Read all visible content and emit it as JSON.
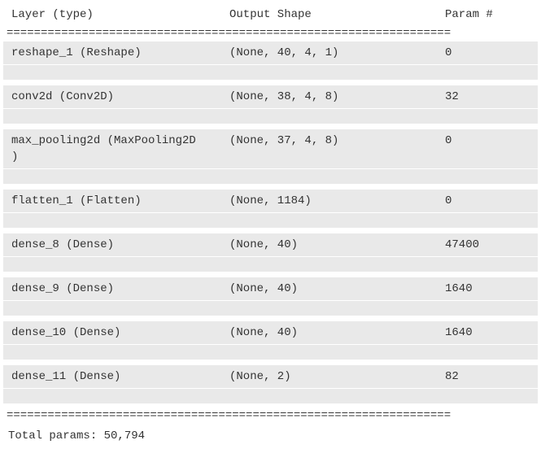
{
  "header": {
    "layer_col": "Layer (type)",
    "shape_col": "Output Shape",
    "param_col": "Param #"
  },
  "divider_double": "=================================================================",
  "layers": [
    {
      "name": "reshape_1 (Reshape)",
      "output_shape": "(None, 40, 4, 1)",
      "params": "0"
    },
    {
      "name": "conv2d (Conv2D)",
      "output_shape": "(None, 38, 4, 8)",
      "params": "32"
    },
    {
      "name": "max_pooling2d (MaxPooling2D",
      "name_overflow": ")",
      "output_shape": "(None, 37, 4, 8)",
      "params": "0"
    },
    {
      "name": "flatten_1 (Flatten)",
      "output_shape": "(None, 1184)",
      "params": "0"
    },
    {
      "name": "dense_8 (Dense)",
      "output_shape": "(None, 40)",
      "params": "47400"
    },
    {
      "name": "dense_9 (Dense)",
      "output_shape": "(None, 40)",
      "params": "1640"
    },
    {
      "name": "dense_10 (Dense)",
      "output_shape": "(None, 40)",
      "params": "1640"
    },
    {
      "name": "dense_11 (Dense)",
      "output_shape": "(None, 2)",
      "params": "82"
    }
  ],
  "footer": {
    "total_params": "Total params: 50,794"
  },
  "chart_data": {
    "type": "table",
    "columns": [
      "Layer (type)",
      "Output Shape",
      "Param #"
    ],
    "rows": [
      [
        "reshape_1 (Reshape)",
        "(None, 40, 4, 1)",
        0
      ],
      [
        "conv2d (Conv2D)",
        "(None, 38, 4, 8)",
        32
      ],
      [
        "max_pooling2d (MaxPooling2D)",
        "(None, 37, 4, 8)",
        0
      ],
      [
        "flatten_1 (Flatten)",
        "(None, 1184)",
        0
      ],
      [
        "dense_8 (Dense)",
        "(None, 40)",
        47400
      ],
      [
        "dense_9 (Dense)",
        "(None, 40)",
        1640
      ],
      [
        "dense_10 (Dense)",
        "(None, 40)",
        1640
      ],
      [
        "dense_11 (Dense)",
        "(None, 2)",
        82
      ]
    ],
    "total_params": 50794
  }
}
